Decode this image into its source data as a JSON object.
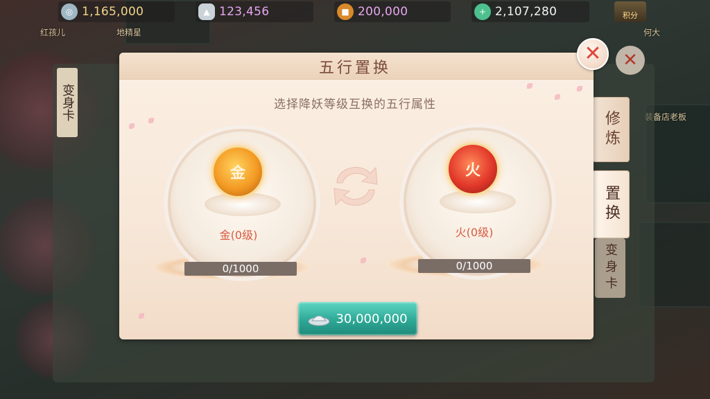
{
  "resources": [
    {
      "name": "silver-coin",
      "value": "1,165,000",
      "color": "#f2d48a",
      "icon_color": "#9fb7c4"
    },
    {
      "name": "silver-ingot",
      "value": "123,456",
      "color": "#e6a6f0",
      "icon_color": "#dfe6ea"
    },
    {
      "name": "copper-coin",
      "value": "200,000",
      "color": "#e6a6f0",
      "icon_color": "#d9892a"
    },
    {
      "name": "jade",
      "value": "2,107,280",
      "color": "#f2f2f2",
      "icon_color": "#4cc08e"
    }
  ],
  "score_label": "积分",
  "npcs": [
    "红孩儿",
    "地精星",
    "何大",
    "装备店老板"
  ],
  "outer_tab": "变身卡",
  "panel": {
    "title": "五行置换",
    "subtitle": "选择降妖等级互换的五行属性"
  },
  "tabs": {
    "cultivate": "修炼",
    "replace": "置换",
    "transform": "变身卡"
  },
  "left_element": {
    "glyph": "金",
    "label": "金(0级)",
    "progress": "0/1000"
  },
  "right_element": {
    "glyph": "火",
    "label": "火(0级)",
    "progress": "0/1000"
  },
  "cost": "30,000,000",
  "colors": {
    "accent_teal": "#2ea896",
    "title_brown": "#7a4a3a",
    "label_red": "#d95a40"
  }
}
